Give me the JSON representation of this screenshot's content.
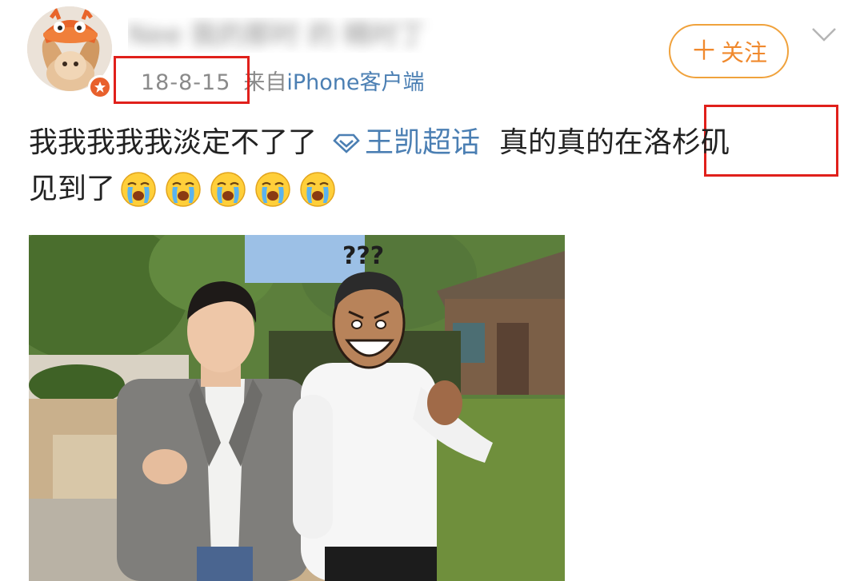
{
  "post": {
    "username": "Nee 我的那时 的 精时丁",
    "timestamp": "18-8-15",
    "source_prefix": "来自",
    "source_client": "iPhone客户端",
    "follow_label": "关注",
    "text_part1": "我我我我我淡定不了了",
    "topic": "王凯超话",
    "text_part2": "真的真的在洛杉矶",
    "text_line2": "见到了",
    "emoji_count": 5,
    "emoji_name": "crying-face-icon",
    "photo_caption": "???"
  },
  "colors": {
    "link": "#4b7fb3",
    "follow": "#f0892d",
    "highlight_box": "#e0201b",
    "verify_badge": "#e8602c"
  }
}
